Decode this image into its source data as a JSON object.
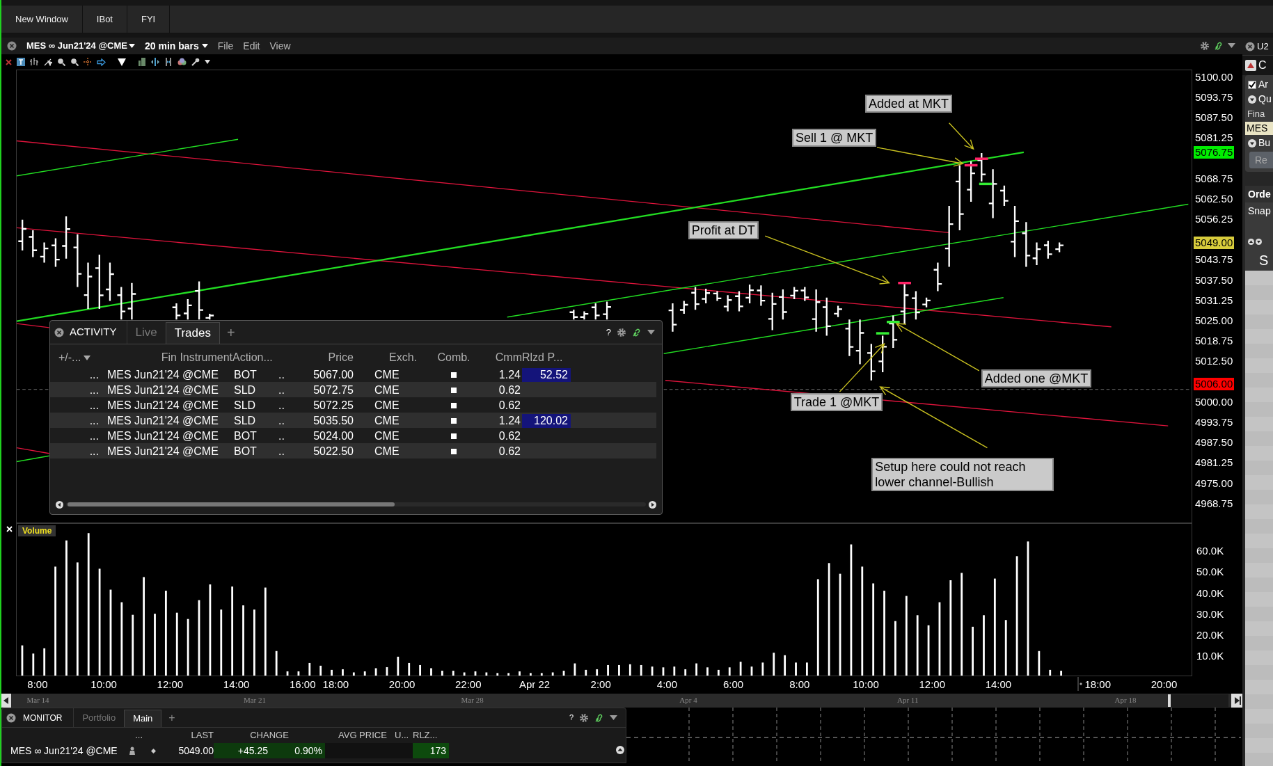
{
  "top_bar": {
    "buttons": [
      "New Window",
      "IBot",
      "FYI"
    ]
  },
  "chart_window": {
    "symbol": "MES ∞ Jun21'24 @CME",
    "bar_size": "20 min bars",
    "menus": [
      "File",
      "Edit",
      "View"
    ]
  },
  "price_pane": {
    "axis_labels": [
      "5100.00",
      "5093.75",
      "5087.50",
      "5081.25",
      "5068.75",
      "5062.50",
      "5056.25",
      "5043.75",
      "5037.50",
      "5031.25",
      "5025.00",
      "5018.75",
      "5012.50",
      "5000.00",
      "4993.75",
      "4987.50",
      "4981.25",
      "4975.00",
      "4968.75"
    ],
    "price_tags": [
      {
        "label": "5076.75",
        "color": "#00ee00"
      },
      {
        "label": "5049.00",
        "color": "#d8cc3c"
      },
      {
        "label": "5006.00",
        "color": "#ff0000"
      }
    ],
    "annotations": [
      "Added at MKT",
      "Sell 1 @ MKT",
      "Profit at DT",
      "Added one @MKT",
      "Trade 1 @MKT",
      "Setup here could not reach lower channel-Bullish"
    ]
  },
  "activity": {
    "title": "ACTIVITY",
    "tabs": [
      {
        "label": "Live",
        "selected": false
      },
      {
        "label": "Trades",
        "selected": true
      }
    ],
    "add_tab": "+",
    "help": "?",
    "columns": [
      "+/-...",
      "Fin Instrument",
      "Action...",
      "Price",
      "Exch.",
      "Comb.",
      "Cmm",
      "Rlzd P..."
    ],
    "rows": [
      {
        "more": "...",
        "instrument": "MES Jun21'24 @CME",
        "action": "BOT",
        "flag": "..",
        "price": "5067.00",
        "exchange": "CME",
        "commission": "1.24",
        "realized": "52.52"
      },
      {
        "more": "...",
        "instrument": "MES Jun21'24 @CME",
        "action": "SLD",
        "flag": "..",
        "price": "5072.75",
        "exchange": "CME",
        "commission": "0.62"
      },
      {
        "more": "...",
        "instrument": "MES Jun21'24 @CME",
        "action": "SLD",
        "flag": "..",
        "price": "5072.25",
        "exchange": "CME",
        "commission": "0.62"
      },
      {
        "more": "...",
        "instrument": "MES Jun21'24 @CME",
        "action": "SLD",
        "flag": "..",
        "price": "5035.50",
        "exchange": "CME",
        "commission": "1.24",
        "realized": "120.02"
      },
      {
        "more": "...",
        "instrument": "MES Jun21'24 @CME",
        "action": "BOT",
        "flag": "..",
        "price": "5024.00",
        "exchange": "CME",
        "commission": "0.62"
      },
      {
        "more": "...",
        "instrument": "MES Jun21'24 @CME",
        "action": "BOT",
        "flag": "..",
        "price": "5022.50",
        "exchange": "CME",
        "commission": "0.62"
      }
    ]
  },
  "volume_pane": {
    "label": "Volume",
    "chart_data": {
      "type": "bar",
      "categories": [
        null,
        "8:00",
        null,
        null,
        null,
        null,
        null,
        "10:00",
        null,
        null,
        null,
        null,
        null,
        "12:00",
        null,
        null,
        null,
        null,
        null,
        "14:00",
        null,
        null,
        null,
        null,
        null,
        "16:00",
        null,
        null,
        "18:00",
        null,
        null,
        null,
        null,
        null,
        "20:00",
        null,
        null,
        null,
        null,
        null,
        "22:00",
        null,
        null,
        null,
        null,
        null,
        "Apr 22",
        null,
        null,
        null,
        null,
        null,
        "2:00",
        null,
        null,
        null,
        null,
        null,
        "4:00",
        null,
        null,
        null,
        null,
        null,
        "6:00",
        null,
        null,
        null,
        null,
        null,
        "8:00",
        null,
        null,
        null,
        null,
        null,
        "10:00",
        null,
        null,
        null,
        null,
        null,
        "12:00",
        null,
        null,
        null,
        null,
        null,
        "14:00",
        null,
        null,
        null,
        null,
        null,
        null,
        null,
        null,
        "18:00",
        null,
        null,
        null,
        null,
        null,
        "20:00"
      ],
      "values": [
        14400,
        10500,
        13000,
        52000,
        64500,
        54000,
        68000,
        51000,
        41000,
        35000,
        29000,
        47000,
        29500,
        40500,
        30000,
        27000,
        36000,
        43500,
        31500,
        42500,
        33500,
        31500,
        42000,
        11700,
        2000,
        2000,
        6000,
        4700,
        2700,
        3000,
        1500,
        2000,
        3500,
        4000,
        9000,
        6000,
        5000,
        3500,
        2300,
        2300,
        1500,
        2000,
        1500,
        1200,
        1200,
        2000,
        1200,
        1200,
        1500,
        2300,
        5800,
        2700,
        3000,
        5000,
        5000,
        5400,
        5000,
        4300,
        3900,
        4300,
        3000,
        5800,
        3900,
        2700,
        3900,
        6600,
        4300,
        6200,
        10900,
        9700,
        6200,
        6200,
        46000,
        53700,
        48600,
        62600,
        52000,
        44000,
        40500,
        26000,
        38000,
        28800,
        24000,
        35000,
        45500,
        49000,
        23300,
        28800,
        46300,
        26500,
        57000,
        64000,
        11700,
        2700,
        2300,
        null,
        null,
        null,
        null,
        null,
        null,
        null,
        null,
        null
      ],
      "ylim": [
        0,
        72400
      ],
      "yticks": [
        {
          "value": 10000,
          "label": "10.0K"
        },
        {
          "value": 20000,
          "label": "20.0K"
        },
        {
          "value": 30000,
          "label": "30.0K"
        },
        {
          "value": 40000,
          "label": "40.0K"
        },
        {
          "value": 50000,
          "label": "50.0K"
        },
        {
          "value": 60000,
          "label": "60.0K"
        }
      ]
    }
  },
  "navigator": {
    "dates": [
      "Mar 14",
      "Mar 21",
      "Mar 28",
      "Apr 4",
      "Apr 11",
      "Apr 18"
    ]
  },
  "monitor": {
    "title": "MONITOR",
    "tabs": [
      {
        "label": "Portfolio",
        "selected": false
      },
      {
        "label": "Main",
        "selected": true
      }
    ],
    "add_tab": "+",
    "help": "?",
    "columns": [
      "...",
      "LAST",
      "CHANGE",
      "AVG PRICE",
      "U...",
      "RLZ..."
    ],
    "rows": [
      {
        "instrument": "MES ∞ Jun21'24 @CME",
        "last": "5049.00",
        "change": "+45.25",
        "change_pct": "0.90%",
        "realized": "173"
      }
    ]
  },
  "right_panel": {
    "tab": "U2",
    "header": "C",
    "items": [
      {
        "kind": "checkbox",
        "label": "Ar",
        "checked": true
      },
      {
        "kind": "expander",
        "label": "Qu"
      },
      {
        "kind": "text",
        "label": "Fina"
      },
      {
        "kind": "field",
        "label": "MES"
      },
      {
        "kind": "expander",
        "label": "Bu"
      },
      {
        "kind": "button",
        "label": "Re"
      }
    ],
    "order_title": "Orde",
    "order_subtitle": "Snap",
    "column_label": "S"
  }
}
